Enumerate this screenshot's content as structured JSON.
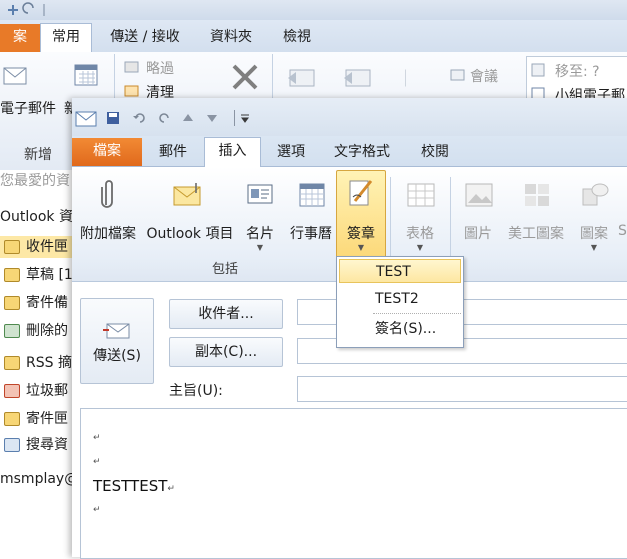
{
  "background_window": {
    "tabs": {
      "file": "案",
      "home": "常用",
      "send_receive": "傳送 / 接收",
      "folder": "資料夾",
      "view": "檢視"
    },
    "ribbon": {
      "new_email": "電子郵件",
      "new_group_label": "新增",
      "ignore": "略過",
      "clean_up": "清理",
      "move_to": "移至: ?",
      "team_email": "小組電子郵",
      "meeting": "會議"
    },
    "nav": {
      "favorites": "您最愛的資",
      "account": "Outlook 資",
      "folders": [
        "收件匣",
        "草稿 [1",
        "寄件備",
        "刪除的",
        "RSS 摘",
        "垃圾郵",
        "寄件匣",
        "搜尋資"
      ],
      "account_footer": "msmplay@"
    }
  },
  "compose_window": {
    "tabs": {
      "file": "檔案",
      "message": "郵件",
      "insert": "插入",
      "options": "選項",
      "format_text": "文字格式",
      "review": "校閱"
    },
    "ribbon": {
      "attach_file": "附加檔案",
      "outlook_item": "Outlook 項目",
      "business_card": "名片",
      "calendar": "行事曆",
      "signature": "簽章",
      "table": "表格",
      "picture": "圖片",
      "clip_art": "美工圖案",
      "shapes": "圖案",
      "smartart": "S",
      "group_include": "包括"
    },
    "signature_menu": [
      "TEST",
      "TEST2",
      "簽名(S)..."
    ],
    "send_label": "傳送(S)",
    "to_button": "收件者...",
    "cc_button": "副本(C)...",
    "subject_label": "主旨(U):",
    "body_text": "TESTTEST"
  }
}
